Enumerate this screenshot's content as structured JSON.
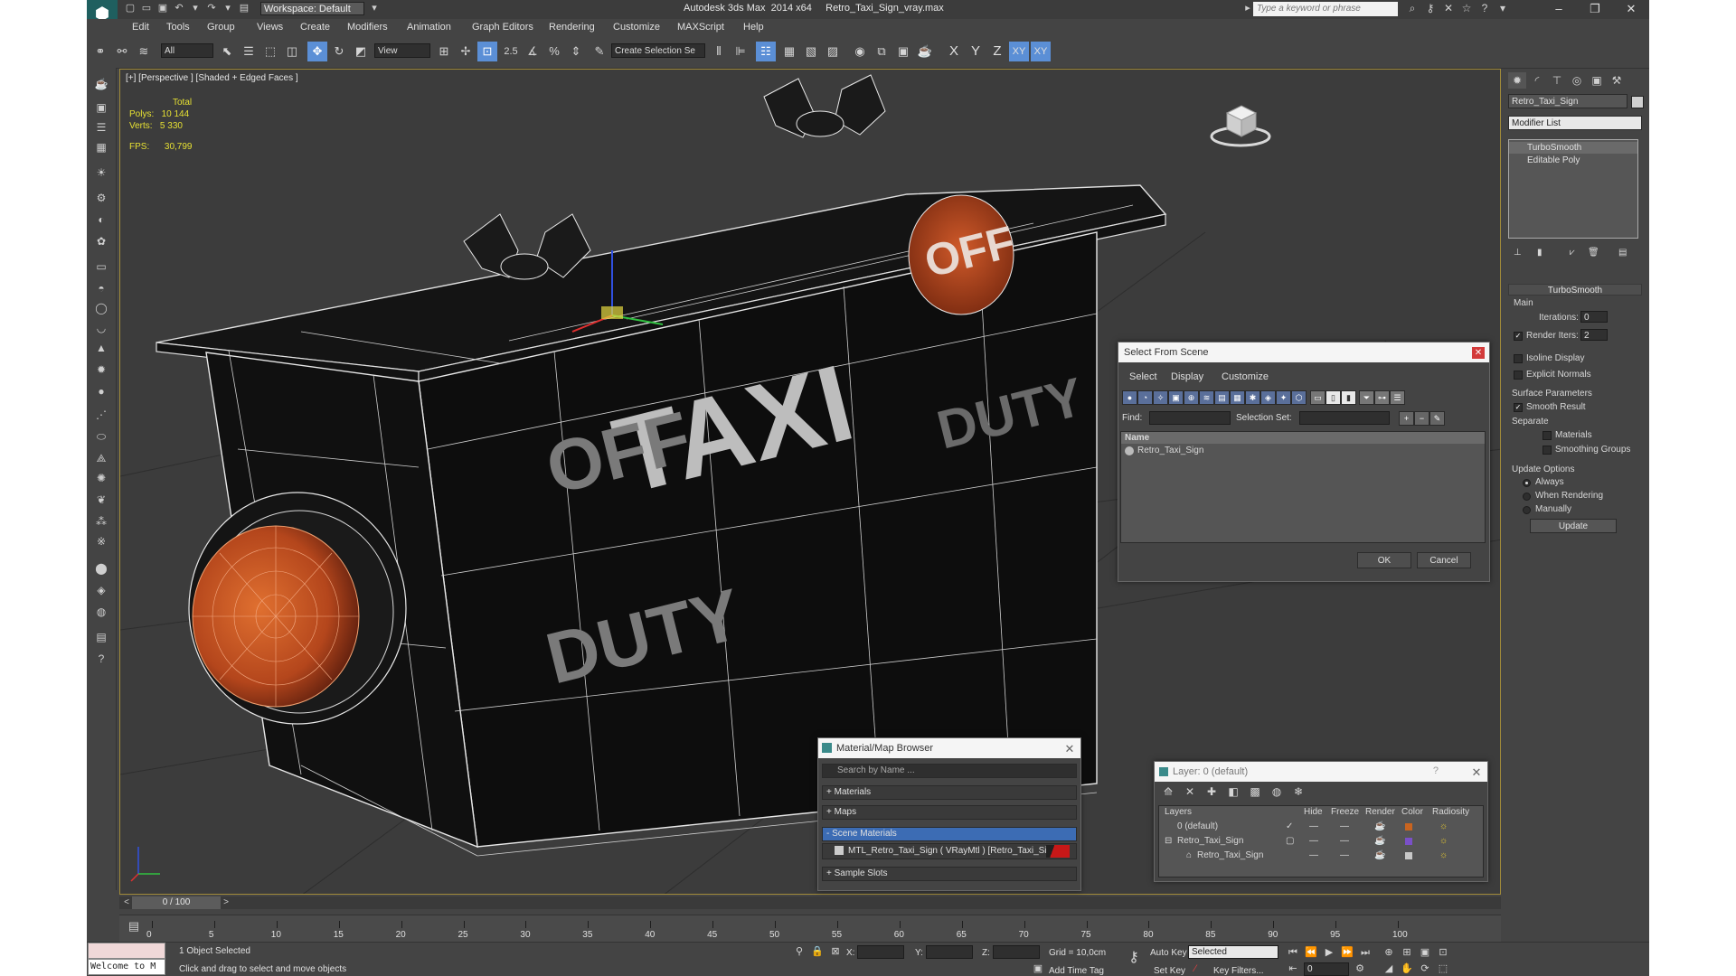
{
  "titlebar": {
    "workspace": "Workspace: Default",
    "title": "Autodesk 3ds Max  2014 x64     Retro_Taxi_Sign_vray.max",
    "search_placeholder": "Type a keyword or phrase"
  },
  "menu": [
    "Edit",
    "Tools",
    "Group",
    "Views",
    "Create",
    "Modifiers",
    "Animation",
    "Graph Editors",
    "Rendering",
    "Customize",
    "MAXScript",
    "Help"
  ],
  "toolbar": {
    "filter_select": "All",
    "coord_select": "View",
    "snap_label": "2.5",
    "named_sel": "Create Selection Se",
    "axis_x": "X",
    "axis_y": "Y",
    "axis_z": "Z",
    "axis_xy": "XY",
    "axis_xy2": "XY"
  },
  "viewport": {
    "label": "[+] [Perspective ] [Shaded + Edged Faces ]",
    "stats_total": "Total",
    "polys_label": "Polys:",
    "polys_value": "10 144",
    "verts_label": "Verts:",
    "verts_value": "5 330",
    "fps_label": "FPS:",
    "fps_value": "30,799"
  },
  "model_texts": {
    "taxi": "TAXI",
    "off": "OFF",
    "duty": "DUTY"
  },
  "right_panel": {
    "object_name": "Retro_Taxi_Sign",
    "modifier_list": "Modifier List",
    "stack": [
      "TurboSmooth",
      "Editable Poly"
    ],
    "rollout_title": "TurboSmooth",
    "main_label": "Main",
    "iterations_label": "Iterations:",
    "iterations_value": "0",
    "render_iters_label": "Render Iters:",
    "render_iters_value": "2",
    "isoline": "Isoline Display",
    "explicit_normals": "Explicit Normals",
    "surface_params": "Surface Parameters",
    "smooth_result": "Smooth Result",
    "separate": "Separate",
    "materials": "Materials",
    "smoothing_groups": "Smoothing Groups",
    "update_options": "Update Options",
    "always": "Always",
    "when_rendering": "When Rendering",
    "manually": "Manually",
    "update_btn": "Update"
  },
  "select_dialog": {
    "title": "Select From Scene",
    "menu": [
      "Select",
      "Display",
      "Customize"
    ],
    "find_label": "Find:",
    "selection_set_label": "Selection Set:",
    "col_name": "Name",
    "item": "Retro_Taxi_Sign",
    "ok": "OK",
    "cancel": "Cancel"
  },
  "material_browser": {
    "title": "Material/Map Browser",
    "search": "Search by Name ...",
    "materials": "+ Materials",
    "maps": "+ Maps",
    "scene_materials": "- Scene Materials",
    "material_item": "MTL_Retro_Taxi_Sign  ( VRayMtl )  [Retro_Taxi_Sign]",
    "sample_slots": "+ Sample Slots"
  },
  "layer_dialog": {
    "title": "Layer: 0 (default)",
    "help": "?",
    "cols": [
      "Layers",
      "Hide",
      "Freeze",
      "Render",
      "Color",
      "Radiosity"
    ],
    "rows": [
      "0 (default)",
      "Retro_Taxi_Sign",
      "Retro_Taxi_Sign"
    ],
    "colors": [
      "#c86420",
      "#7a50c8",
      "#c8c8c8"
    ]
  },
  "timeline": {
    "frame": "0 / 100",
    "ticks": [
      "0",
      "5",
      "10",
      "15",
      "20",
      "25",
      "30",
      "35",
      "40",
      "45",
      "50",
      "55",
      "60",
      "65",
      "70",
      "75",
      "80",
      "85",
      "90",
      "95",
      "100"
    ]
  },
  "statusbar": {
    "maxscript": "Welcome to M",
    "selected": "1 Object Selected",
    "prompt": "Click and drag to select and move objects",
    "x_label": "X:",
    "y_label": "Y:",
    "z_label": "Z:",
    "grid": "Grid = 10,0cm",
    "add_time_tag": "Add Time Tag",
    "auto_key": "Auto Key",
    "set_key": "Set Key",
    "selected_dd": "Selected",
    "key_filters": "Key Filters...",
    "frame_value": "0"
  },
  "colors": {
    "accent": "#5b8fd6",
    "viewport_border": "#a08a3a",
    "stats": "#e6e033"
  }
}
